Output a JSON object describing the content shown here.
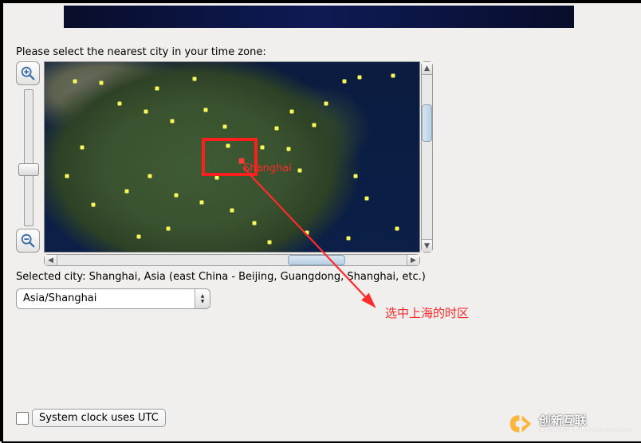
{
  "prompt": "Please select the nearest city in your time zone:",
  "map": {
    "shanghai_label": "Shanghai",
    "selected_city_line": "Selected city: Shanghai, Asia (east China - Beijing, Guangdong, Shanghai, etc.)"
  },
  "timezone_combo": {
    "value": "Asia/Shanghai"
  },
  "annotation": {
    "text": "选中上海的时区"
  },
  "utc_checkbox": {
    "checked": false,
    "label": "System clock uses UTC"
  },
  "watermark": {
    "brand": "创新互联",
    "sub": "CXHLCOM·CHUANGXINHULIAN"
  }
}
